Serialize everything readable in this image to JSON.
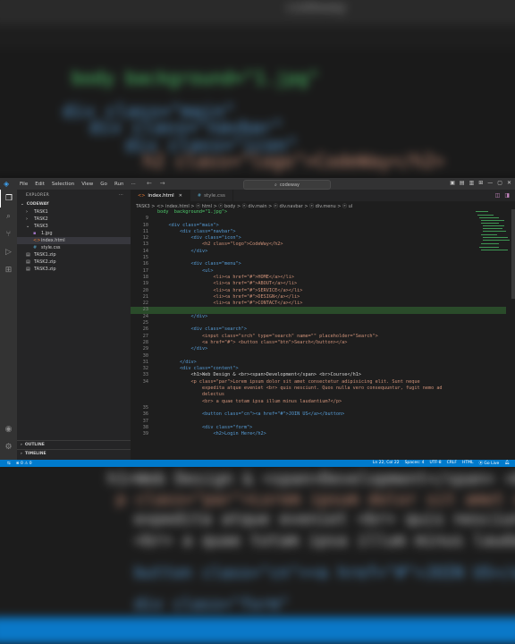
{
  "background": {
    "title": "codeway",
    "top_code_lines": [
      "body background=\"1.jpg\"",
      "div class=\"main\"",
      "div class=\"navbar\"",
      "div class=\"icon\"",
      "h2 class=\"logo\">CodeWay</h2>"
    ],
    "bottom_code_lines": [
      "h1>Web Design & <span>Development</span> <br>Course</h1>",
      "p class=\"par\">Lorem ipsum dolor sit amet consectetur adipisicing",
      "expedita atque eveniet <br> quis nesciunt. Quos nulla vero",
      "<br> a quae totam ipsa illum minus laudantium?</p>",
      "button class=\"cn\"><a href=\"#\">JOIN US</a></button>",
      "div class=\"form\""
    ]
  },
  "titlebar": {
    "menu": [
      "File",
      "Edit",
      "Selection",
      "View",
      "Go",
      "Run",
      "···"
    ],
    "search": "codeway",
    "nav_back": "←",
    "nav_forward": "→"
  },
  "activity_bar": {
    "top": [
      "files-icon",
      "search-icon",
      "source-control-icon",
      "run-debug-icon",
      "extensions-icon"
    ],
    "bottom": [
      "account-icon",
      "settings-icon"
    ]
  },
  "sidebar": {
    "header": "EXPLORER",
    "header_more": "···",
    "section": "CODEWAY",
    "items": [
      {
        "label": "TASK1",
        "kind": "folder",
        "depth": 0
      },
      {
        "label": "TASK2",
        "kind": "folder",
        "depth": 0
      },
      {
        "label": "TASK3",
        "kind": "folder-open",
        "depth": 0
      },
      {
        "label": "1.jpg",
        "kind": "image",
        "depth": 1
      },
      {
        "label": "index.html",
        "kind": "html",
        "depth": 1,
        "selected": true
      },
      {
        "label": "style.css",
        "kind": "css",
        "depth": 1
      },
      {
        "label": "TASK1.zip",
        "kind": "zip",
        "depth": 0
      },
      {
        "label": "TASK2.zip",
        "kind": "zip",
        "depth": 0
      },
      {
        "label": "TASK3.zip",
        "kind": "zip",
        "depth": 0
      }
    ],
    "outline": "OUTLINE",
    "timeline": "TIMELINE"
  },
  "tabs": [
    {
      "label": "index.html",
      "active": true,
      "icon": "html-icon"
    },
    {
      "label": "style.css",
      "active": false,
      "icon": "css-icon"
    }
  ],
  "breadcrumb": "TASK3 > <> index.html > ⓔ html > ⓔ body > ⓔ div.main > ⓔ div.navbar > ⓔ div.menu > ⓔ ul",
  "code_lines": [
    {
      "n": "",
      "text": "body  background=\"1.jpg\">"
    },
    {
      "n": "9",
      "text": ""
    },
    {
      "n": "10",
      "text": "    <div class=\"main\">"
    },
    {
      "n": "11",
      "text": "        <div class=\"navbar\">"
    },
    {
      "n": "12",
      "text": "            <div class=\"icon\">"
    },
    {
      "n": "13",
      "text": "                <h2 class=\"logo\">CodeWay</h2>"
    },
    {
      "n": "14",
      "text": "            </div>"
    },
    {
      "n": "15",
      "text": ""
    },
    {
      "n": "16",
      "text": "            <div class=\"menu\">"
    },
    {
      "n": "17",
      "text": "                <ul>"
    },
    {
      "n": "18",
      "text": "                    <li><a href=\"#\">HOME</a></li>"
    },
    {
      "n": "19",
      "text": "                    <li><a href=\"#\">ABOUT</a></li>"
    },
    {
      "n": "20",
      "text": "                    <li><a href=\"#\">SERVICE</a></li>"
    },
    {
      "n": "21",
      "text": "                    <li><a href=\"#\">DESIGN</a></li>"
    },
    {
      "n": "22",
      "text": "                    <li><a href=\"#\">CONTACT</a></li>"
    },
    {
      "n": "23",
      "text": "",
      "hl": true
    },
    {
      "n": "24",
      "text": "            </div>"
    },
    {
      "n": "25",
      "text": ""
    },
    {
      "n": "26",
      "text": "            <div class=\"search\">"
    },
    {
      "n": "27",
      "text": "                <input class=\"srch\" type=\"search\" name=\"\" placeholder=\"Search\">"
    },
    {
      "n": "28",
      "text": "                <a href=\"#\"> <button class=\"btn\">Search</button></a>"
    },
    {
      "n": "29",
      "text": "            </div>"
    },
    {
      "n": "30",
      "text": ""
    },
    {
      "n": "31",
      "text": "        </div>"
    },
    {
      "n": "32",
      "text": "        <div class=\"content\">"
    },
    {
      "n": "33",
      "text": "            <h1>Web Design & <br><span>Development</span> <br>Course</h1>"
    },
    {
      "n": "34",
      "text": "            <p class=\"par\">Lorem ipsum dolor sit amet consectetur adipisicing elit. Sunt neque"
    },
    {
      "n": "",
      "text": "                expedita atque eveniet <br> quis nesciunt. Quos nulla vero consequuntur, fugit nemo ad"
    },
    {
      "n": "",
      "text": "                delectus"
    },
    {
      "n": "",
      "text": "                <br> a quae totam ipsa illum minus laudantium?</p>"
    },
    {
      "n": "35",
      "text": ""
    },
    {
      "n": "36",
      "text": "                <button class=\"cn\"><a href=\"#\">JOIN US</a></button>"
    },
    {
      "n": "37",
      "text": ""
    },
    {
      "n": "38",
      "text": "                <div class=\"form\">"
    },
    {
      "n": "39",
      "text": "                    <h2>Login Here</h2>"
    }
  ],
  "statusbar": {
    "left": [
      "⊗ 0 ⚠ 0"
    ],
    "right": [
      "Ln 22, Col 22",
      "Spaces: 4",
      "UTF-8",
      "CRLF",
      "HTML",
      "⦿ Go Live"
    ]
  }
}
